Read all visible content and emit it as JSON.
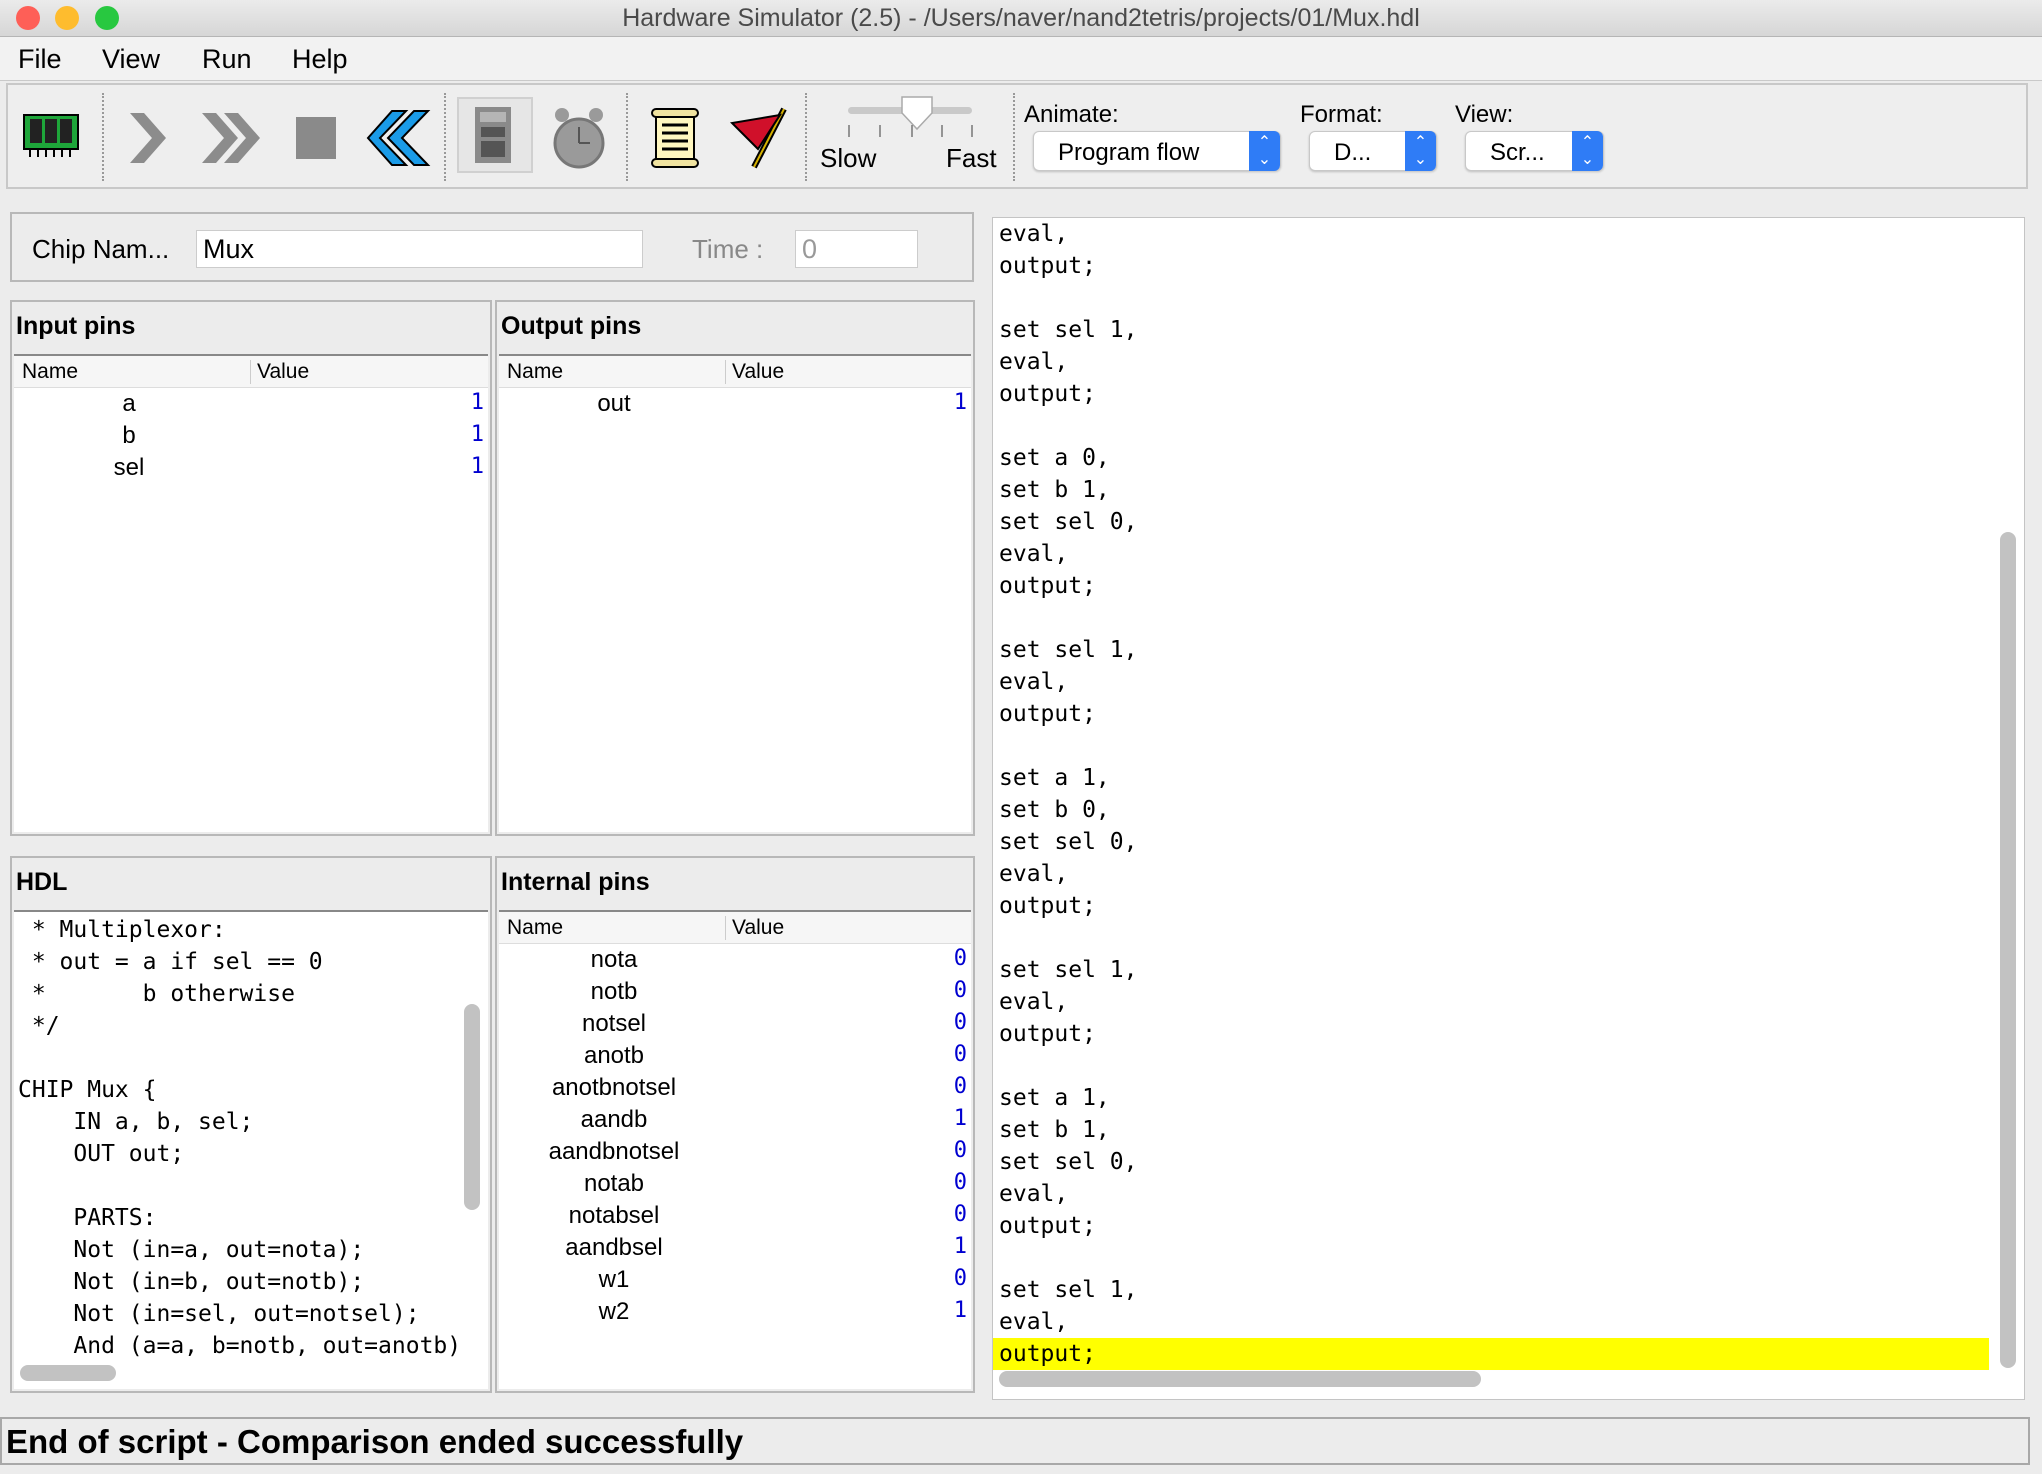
{
  "window": {
    "title": "Hardware Simulator (2.5) - /Users/naver/nand2tetris/projects/01/Mux.hdl"
  },
  "menu": [
    "File",
    "View",
    "Run",
    "Help"
  ],
  "toolbar": {
    "icons": [
      "chip-load-icon",
      "single-step-icon",
      "run-icon",
      "stop-icon",
      "reset-icon",
      "calculator-icon",
      "clock-icon",
      "script-icon",
      "breakpoint-flag-icon"
    ],
    "speed": {
      "slow_label": "Slow",
      "fast_label": "Fast",
      "value_percent": 50
    },
    "animate": {
      "label": "Animate:",
      "value": "Program flow"
    },
    "format": {
      "label": "Format:",
      "value": "D..."
    },
    "view": {
      "label": "View:",
      "value": "Scr..."
    }
  },
  "chip": {
    "name_label": "Chip Nam...",
    "name_value": "Mux",
    "time_label": "Time :",
    "time_value": "0"
  },
  "input_pins": {
    "title": "Input pins",
    "col_name": "Name",
    "col_value": "Value",
    "rows": [
      {
        "name": "a",
        "value": "1"
      },
      {
        "name": "b",
        "value": "1"
      },
      {
        "name": "sel",
        "value": "1"
      }
    ]
  },
  "output_pins": {
    "title": "Output pins",
    "col_name": "Name",
    "col_value": "Value",
    "rows": [
      {
        "name": "out",
        "value": "1"
      }
    ]
  },
  "hdl": {
    "title": "HDL",
    "lines": [
      " * Multiplexor:",
      " * out = a if sel == 0",
      " *       b otherwise",
      " */",
      "",
      "CHIP Mux {",
      "    IN a, b, sel;",
      "    OUT out;",
      "",
      "    PARTS:",
      "    Not (in=a, out=nota);",
      "    Not (in=b, out=notb);",
      "    Not (in=sel, out=notsel);",
      "    And (a=a, b=notb, out=anotb)"
    ]
  },
  "internal_pins": {
    "title": "Internal pins",
    "col_name": "Name",
    "col_value": "Value",
    "rows": [
      {
        "name": "nota",
        "value": "0"
      },
      {
        "name": "notb",
        "value": "0"
      },
      {
        "name": "notsel",
        "value": "0"
      },
      {
        "name": "anotb",
        "value": "0"
      },
      {
        "name": "anotbnotsel",
        "value": "0"
      },
      {
        "name": "aandb",
        "value": "1"
      },
      {
        "name": "aandbnotsel",
        "value": "0"
      },
      {
        "name": "notab",
        "value": "0"
      },
      {
        "name": "notabsel",
        "value": "0"
      },
      {
        "name": "aandbsel",
        "value": "1"
      },
      {
        "name": "w1",
        "value": "0"
      },
      {
        "name": "w2",
        "value": "1"
      }
    ]
  },
  "script": {
    "highlight_color": "#ffff00",
    "highlighted_line": 36,
    "lines": [
      "eval,",
      "output;",
      "",
      "set sel 1,",
      "eval,",
      "output;",
      "",
      "set a 0,",
      "set b 1,",
      "set sel 0,",
      "eval,",
      "output;",
      "",
      "set sel 1,",
      "eval,",
      "output;",
      "",
      "set a 1,",
      "set b 0,",
      "set sel 0,",
      "eval,",
      "output;",
      "",
      "set sel 1,",
      "eval,",
      "output;",
      "",
      "set a 1,",
      "set b 1,",
      "set sel 0,",
      "eval,",
      "output;",
      "",
      "set sel 1,",
      "eval,",
      "output;"
    ]
  },
  "status": {
    "message": "End of script - Comparison ended successfully"
  }
}
